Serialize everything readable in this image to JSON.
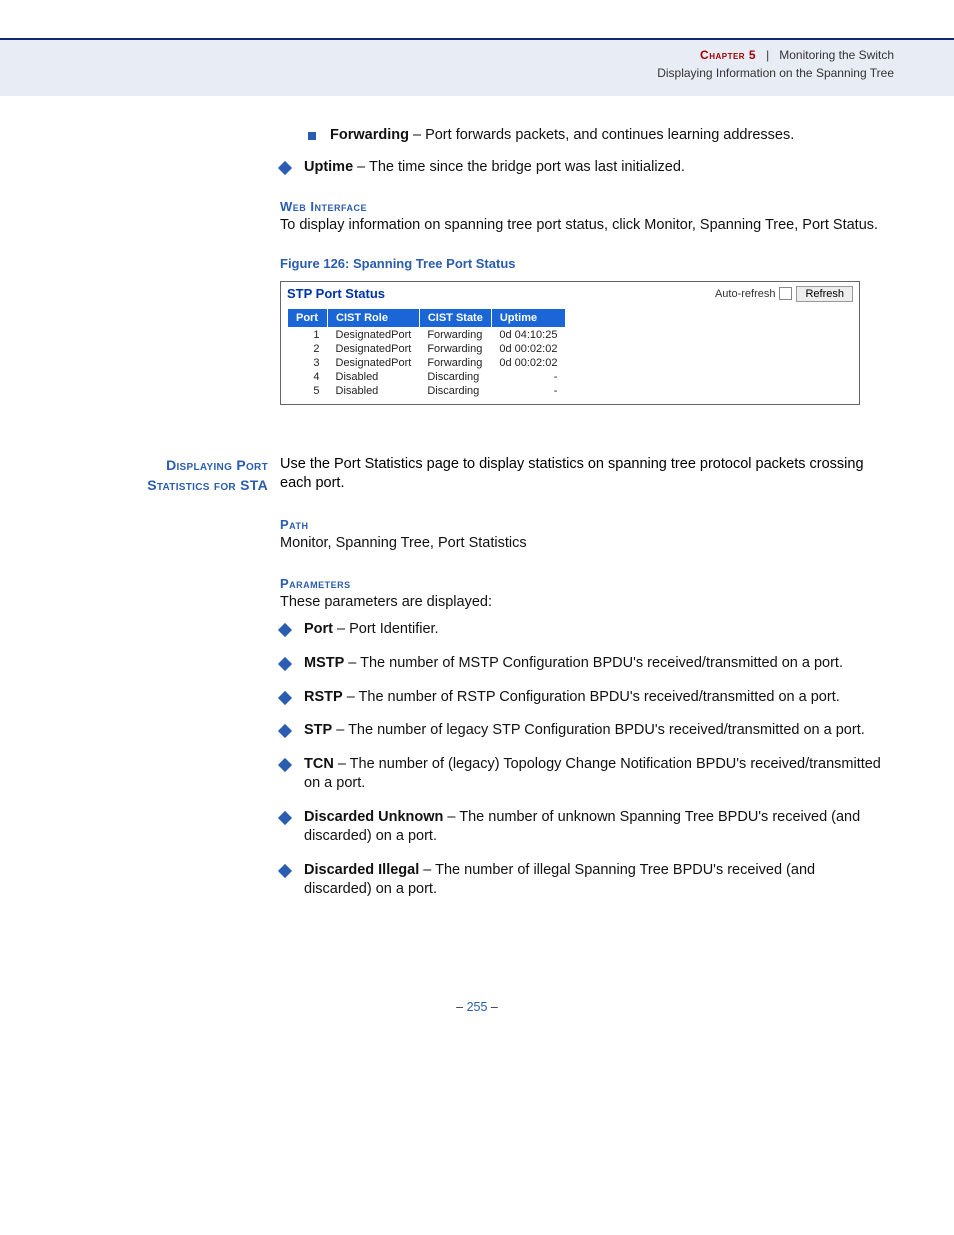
{
  "header": {
    "chapter": "Chapter 5",
    "sep": "|",
    "title": "Monitoring the Switch",
    "subtitle": "Displaying Information on the Spanning Tree"
  },
  "intro": {
    "forwarding_term": "Forwarding",
    "forwarding_desc": " – Port forwards packets, and continues learning addresses.",
    "uptime_term": "Uptime",
    "uptime_desc": " – The time since the bridge port was last initialized."
  },
  "web": {
    "heading": "Web Interface",
    "body": "To display information on spanning tree port status, click Monitor, Spanning Tree, Port Status."
  },
  "figure": {
    "label": "Figure 126:  Spanning Tree Port Status",
    "title": "STP Port Status",
    "auto_refresh": "Auto-refresh",
    "refresh": "Refresh",
    "headers": {
      "port": "Port",
      "role": "CIST Role",
      "state": "CIST State",
      "uptime": "Uptime"
    },
    "rows": [
      {
        "port": "1",
        "role": "DesignatedPort",
        "state": "Forwarding",
        "uptime": "0d 04:10:25"
      },
      {
        "port": "2",
        "role": "DesignatedPort",
        "state": "Forwarding",
        "uptime": "0d 00:02:02"
      },
      {
        "port": "3",
        "role": "DesignatedPort",
        "state": "Forwarding",
        "uptime": "0d 00:02:02"
      },
      {
        "port": "4",
        "role": "Disabled",
        "state": "Discarding",
        "uptime": "-"
      },
      {
        "port": "5",
        "role": "Disabled",
        "state": "Discarding",
        "uptime": "-"
      }
    ]
  },
  "section2": {
    "side_l1": "Displaying Port",
    "side_l2": "Statistics for STA",
    "intro": "Use the Port Statistics page to display statistics on spanning tree protocol packets crossing each port.",
    "path_h": "Path",
    "path_b": "Monitor, Spanning Tree, Port Statistics",
    "param_h": "Parameters",
    "param_b": "These parameters are displayed:",
    "items": [
      {
        "term": "Port",
        "desc": " – Port Identifier."
      },
      {
        "term": "MSTP",
        "desc": " – The number of MSTP Configuration BPDU's received/transmitted on a port."
      },
      {
        "term": "RSTP",
        "desc": " – The number of RSTP Configuration BPDU's received/transmitted on a port."
      },
      {
        "term": "STP",
        "desc": " – The number of legacy STP Configuration BPDU's received/transmitted on a port."
      },
      {
        "term": "TCN",
        "desc": " – The number of (legacy) Topology Change Notification BPDU's received/transmitted on a port."
      },
      {
        "term": "Discarded Unknown",
        "desc": " – The number of unknown Spanning Tree BPDU's received (and discarded) on a port."
      },
      {
        "term": "Discarded Illegal",
        "desc": " – The number of illegal Spanning Tree BPDU's received (and discarded) on a port."
      }
    ]
  },
  "footer": {
    "dash1": "–",
    "num": "255",
    "dash2": "–"
  }
}
